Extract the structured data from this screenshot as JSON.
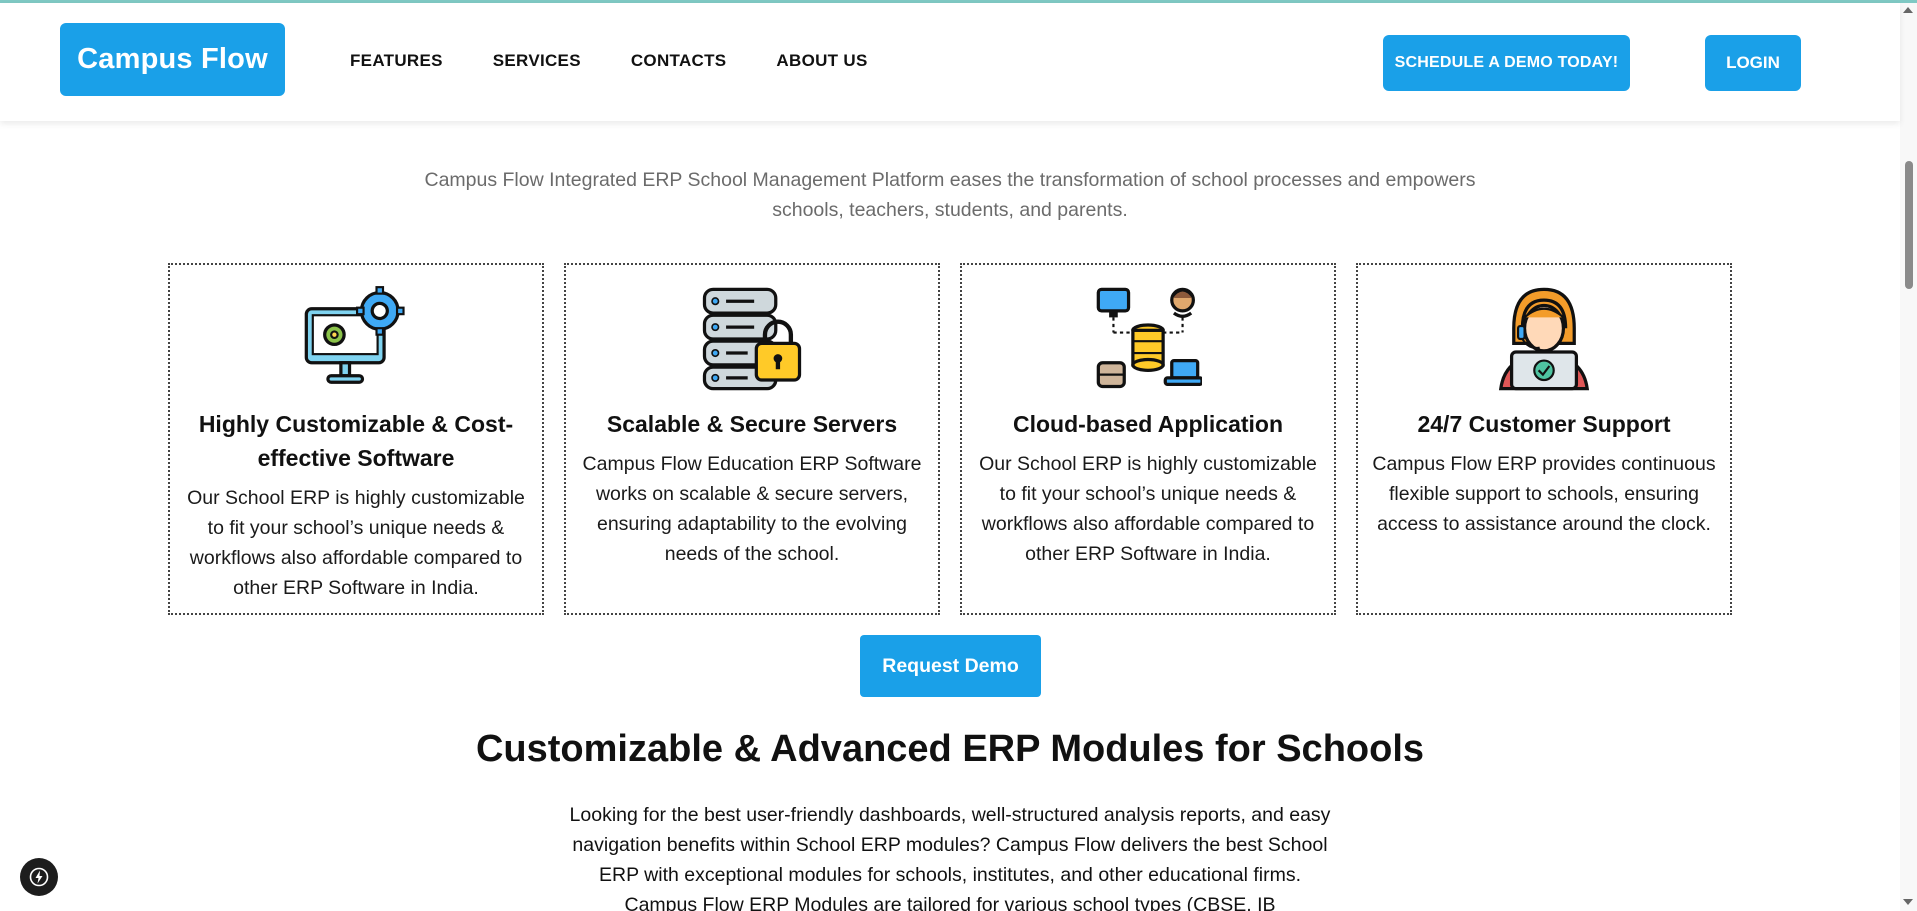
{
  "header": {
    "logo": "Campus Flow",
    "nav": [
      "FEATURES",
      "SERVICES",
      "CONTACTS",
      "ABOUT US"
    ],
    "demo_button": "SCHEDULE A DEMO TODAY!",
    "login_button": "LOGIN"
  },
  "intro": "Campus Flow Integrated ERP School Management Platform eases the transformation of school processes and empowers schools, teachers, students, and parents.",
  "cards": [
    {
      "icon": "monitor-gears-icon",
      "title": "Highly Customizable & Cost-effective Software",
      "text": "Our School ERP is highly customizable to fit your school’s unique needs & workflows also affordable compared to other ERP Software in India."
    },
    {
      "icon": "secure-server-icon",
      "title": "Scalable & Secure Servers",
      "text": "Campus Flow Education ERP Software works on scalable & secure servers, ensuring adaptability to the evolving needs of the school."
    },
    {
      "icon": "cloud-network-icon",
      "title": "Cloud-based Application",
      "text": "Our School ERP is highly customizable to fit your school’s unique needs & workflows also affordable compared to other ERP Software in India."
    },
    {
      "icon": "support-agent-icon",
      "title": "24/7 Customer Support",
      "text": "Campus Flow ERP provides continuous flexible support to schools, ensuring access to assistance around the clock."
    }
  ],
  "request_button": "Request Demo",
  "modules": {
    "title": "Customizable & Advanced ERP Modules for Schools",
    "text": "Looking for the best user-friendly dashboards, well-structured analysis reports, and easy navigation benefits within School ERP modules? Campus Flow delivers the best School ERP with exceptional modules for schools, institutes, and other educational firms. Campus Flow ERP Modules are tailored for various school types (CBSE, IB"
  },
  "colors": {
    "accent": "#1aa0e8"
  },
  "badge_icon": "lightning-icon"
}
